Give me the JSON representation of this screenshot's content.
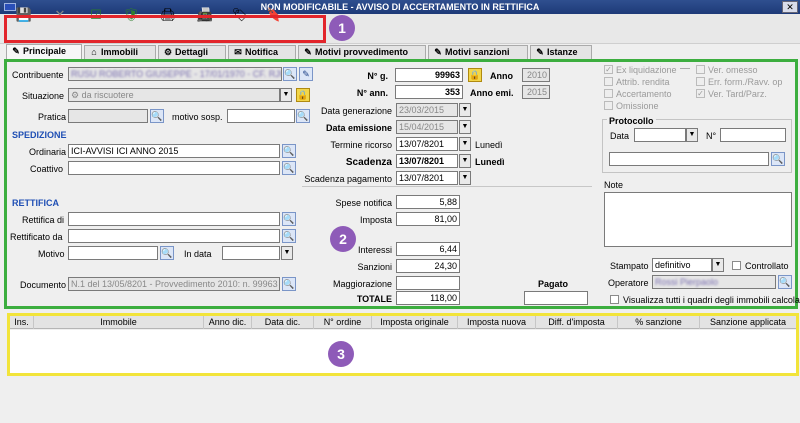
{
  "window": {
    "title": "NON MODIFICABILE - AVVISO DI ACCERTAMENTO IN RETTIFICA"
  },
  "toolbar": {
    "buttons": [
      {
        "name": "save-button",
        "icon": "💾"
      },
      {
        "name": "cancel-button",
        "icon": "✕"
      },
      {
        "name": "validate-button",
        "icon": "☑"
      },
      {
        "name": "protect-button",
        "icon": "🛡"
      },
      {
        "name": "print-button",
        "icon": "🖨"
      },
      {
        "name": "print-preview-button",
        "icon": "📠"
      },
      {
        "name": "tags-docs-button",
        "icon": "🏷"
      },
      {
        "name": "tag-button",
        "icon": "🔖"
      }
    ]
  },
  "badges": {
    "one": "1",
    "two": "2",
    "three": "3"
  },
  "tabs": [
    {
      "label": "Principale",
      "icon": "✎"
    },
    {
      "label": "Immobili",
      "icon": "⌂"
    },
    {
      "label": "Dettagli",
      "icon": "⚙"
    },
    {
      "label": "Notifica",
      "icon": "✉"
    },
    {
      "label": "Motivi provvedimento",
      "icon": "✎"
    },
    {
      "label": "Motivi sanzioni",
      "icon": "✎"
    },
    {
      "label": "Istanze",
      "icon": "✎"
    }
  ],
  "left": {
    "contribuente_label": "Contribuente",
    "contribuente_value": "RUSU ROBERTO GIUSEPPE - 17/01/1970 - CF. RJUBRT",
    "situazione_label": "Situazione",
    "situazione_value": "da riscuotere",
    "pratica_label": "Pratica",
    "motivo_sosp_label": "motivo sosp.",
    "spedizione_title": "SPEDIZIONE",
    "ordinaria_label": "Ordinaria",
    "ordinaria_value": "ICI-AVVISI ICI ANNO 2015",
    "coattivo_label": "Coattivo",
    "rettifica_title": "RETTIFICA",
    "rettifica_di_label": "Rettifica di",
    "rettificato_da_label": "Rettificato da",
    "motivo_label": "Motivo",
    "in_data_label": "In data",
    "documento_label": "Documento",
    "documento_value": "N.1 del 13/05/8201 - Provvedimento 2010: n. 99963 e"
  },
  "middle": {
    "ng_label": "N° g.",
    "ng_value": "99963",
    "anno_label": "Anno",
    "anno_value": "2010",
    "nann_label": "N° ann.",
    "nann_value": "353",
    "annoemi_label": "Anno emi.",
    "annoemi_value": "2015",
    "data_generazione_label": "Data generazione",
    "data_generazione_value": "23/03/2015",
    "data_emissione_label": "Data emissione",
    "data_emissione_value": "15/04/2015",
    "termine_ricorso_label": "Termine ricorso",
    "termine_ricorso_value": "13/07/8201",
    "termine_ricorso_day": "Lunedì",
    "scadenza_label": "Scadenza",
    "scadenza_value": "13/07/8201",
    "scadenza_day": "Lunedì",
    "scadenza_pagamento_label": "Scadenza pagamento",
    "scadenza_pagamento_value": "13/07/8201",
    "spese_notifica_label": "Spese notifica",
    "spese_notifica_value": "5,88",
    "imposta_label": "Imposta",
    "imposta_value": "81,00",
    "interessi_label": "Interessi",
    "interessi_value": "6,44",
    "sanzioni_label": "Sanzioni",
    "sanzioni_value": "24,30",
    "maggiorazione_label": "Maggiorazione",
    "maggiorazione_value": "",
    "totale_label": "TOTALE",
    "totale_value": "118,00",
    "pagato_label": "Pagato",
    "pagato_value": ""
  },
  "right": {
    "checks": [
      {
        "label": "Ex liquidazione",
        "checked": true
      },
      {
        "label": "Attrib. rendita",
        "checked": false
      },
      {
        "label": "Accertamento",
        "checked": false
      },
      {
        "label": "Omissione",
        "checked": false
      }
    ],
    "checks2": [
      {
        "label": "Ver. omesso",
        "checked": false
      },
      {
        "label": "Err. form./Ravv. op",
        "checked": false
      },
      {
        "label": "Ver. Tard/Parz.",
        "checked": true
      }
    ],
    "protocollo_title": "Protocollo",
    "data_label": "Data",
    "numero_label": "N°",
    "note_label": "Note",
    "stampato_label": "Stampato",
    "stampato_value": "definitivo",
    "controllato_label": "Controllato",
    "operatore_label": "Operatore",
    "operatore_value": "Rossi Pierpaolo",
    "visualizza_label": "Visualizza tutti i quadri degli immobili calcolati"
  },
  "grid": {
    "columns": [
      "Ins.",
      "Immobile",
      "Anno dic.",
      "Data dic.",
      "N° ordine",
      "Imposta originale",
      "Imposta nuova",
      "Diff. d'imposta",
      "% sanzione",
      "Sanzione applicata"
    ]
  },
  "colors": {
    "toolbar_frame": "#e2252b",
    "main_frame": "#3cae3f",
    "grid_frame": "#f2e43a",
    "badge": "#8e5bb8",
    "section": "#1f4fb4"
  }
}
